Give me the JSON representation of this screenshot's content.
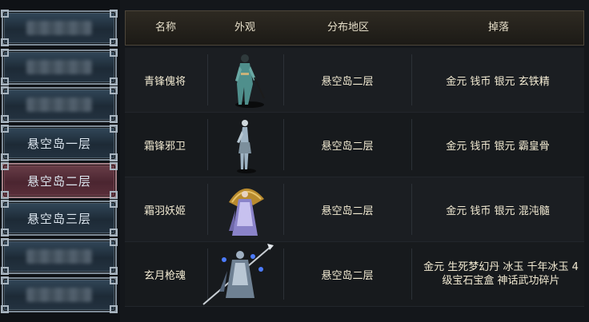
{
  "sidebar": {
    "items": [
      {
        "label": "",
        "blurred": true,
        "active": false
      },
      {
        "label": "",
        "blurred": true,
        "active": false
      },
      {
        "label": "",
        "blurred": true,
        "active": false
      },
      {
        "label": "悬空岛一层",
        "blurred": false,
        "active": false
      },
      {
        "label": "悬空岛二层",
        "blurred": false,
        "active": true
      },
      {
        "label": "悬空岛三层",
        "blurred": false,
        "active": false
      },
      {
        "label": "",
        "blurred": true,
        "active": false
      },
      {
        "label": "",
        "blurred": true,
        "active": false
      }
    ]
  },
  "table": {
    "headers": {
      "name": "名称",
      "look": "外观",
      "area": "分布地区",
      "drops": "掉落"
    },
    "rows": [
      {
        "name": "青锋傀将",
        "area": "悬空岛二层",
        "drops": "金元 钱币 银元 玄铁精",
        "figure": "armored-warrior"
      },
      {
        "name": "霜锋邪卫",
        "area": "悬空岛二层",
        "drops": "金元 钱币 银元 霸皇骨",
        "figure": "slim-guard"
      },
      {
        "name": "霜羽妖姬",
        "area": "悬空岛二层",
        "drops": "金元 钱币 银元 混沌髓",
        "figure": "fan-sorceress"
      },
      {
        "name": "玄月枪魂",
        "area": "悬空岛二层",
        "drops_line1": "金元 生死梦幻丹 冰玉 千年冰玉 4",
        "drops_line2": "级宝石宝盒 神话武功碎片",
        "figure": "spear-spirit"
      }
    ]
  },
  "colors": {
    "active_nav": "#4b2530",
    "nav": "#1d2a36",
    "header_bg": "#2e2a22",
    "text": "#f2ead2"
  }
}
